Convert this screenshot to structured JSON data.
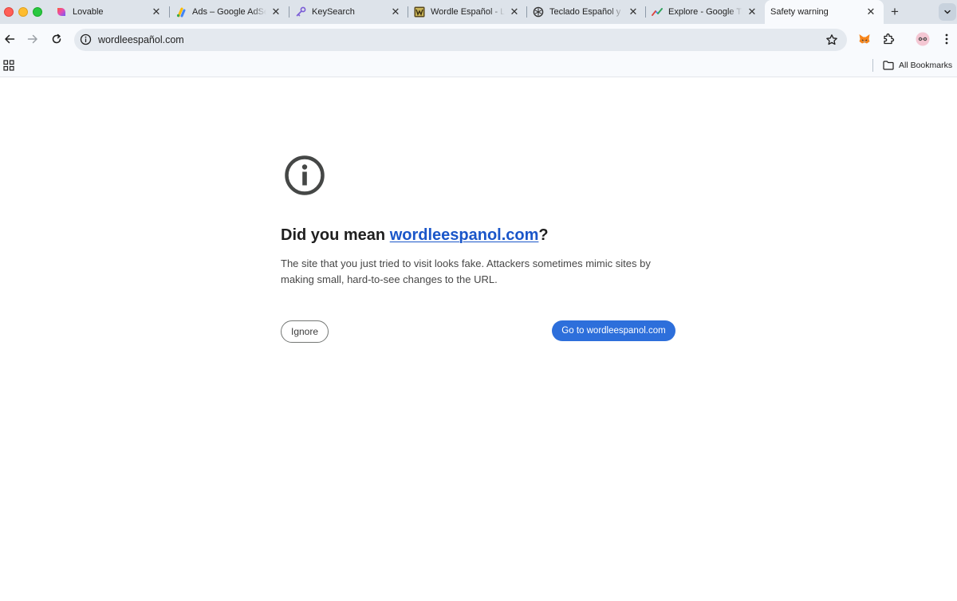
{
  "tabs": [
    {
      "title": "Lovable",
      "icon": "lovable-heart-icon"
    },
    {
      "title": "Ads – Google AdSense",
      "icon": "google-adsense-icon"
    },
    {
      "title": "KeySearch",
      "icon": "keysearch-key-icon"
    },
    {
      "title": "Wordle Español - La",
      "icon": "wordle-w-icon"
    },
    {
      "title": "Teclado Español y R",
      "icon": "openai-logo-icon"
    },
    {
      "title": "Explore - Google Tre",
      "icon": "google-trends-icon"
    }
  ],
  "active_tab": {
    "title": "Safety warning"
  },
  "omnibox": {
    "url": "wordleespañol.com"
  },
  "bookmarks": {
    "all_label": "All Bookmarks"
  },
  "warning": {
    "heading_prefix": "Did you mean ",
    "suggested_domain": "wordleespanol.com",
    "heading_suffix": "?",
    "description": "The site that you just tried to visit looks fake. Attackers sometimes mimic sites by making small, hard-to-see changes to the URL.",
    "ignore_label": "Ignore",
    "go_label": "Go to wordleespanol.com"
  },
  "colors": {
    "tabstrip_bg": "#dde3ea",
    "toolbar_bg": "#f8fafd",
    "link": "#1a56c9",
    "primary_button": "#2d6fdb"
  }
}
